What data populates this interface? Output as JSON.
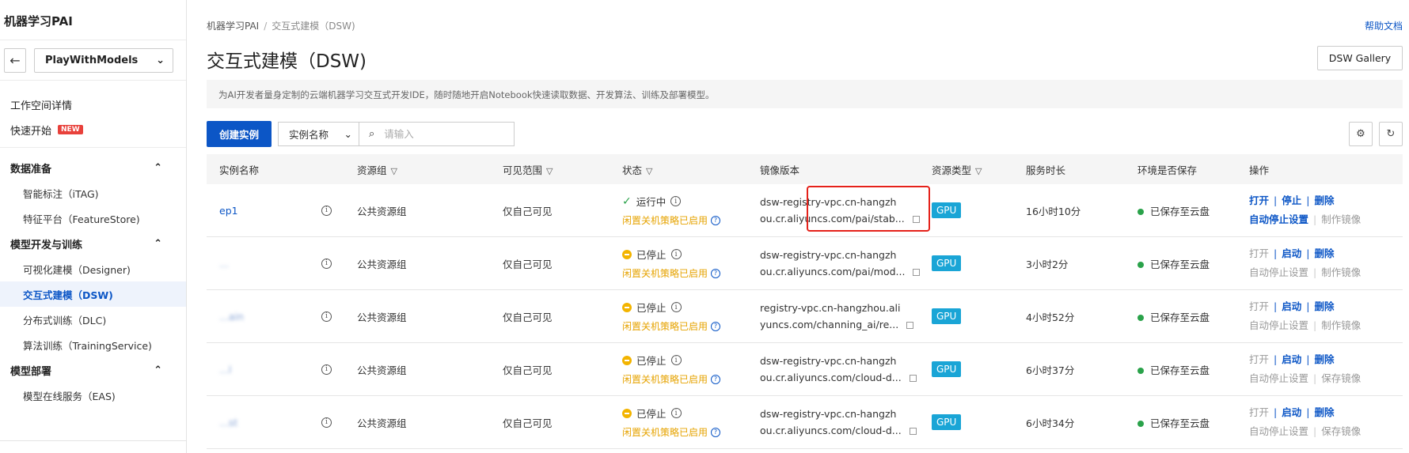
{
  "sidebar": {
    "brand": "机器学习PAI",
    "workspace": "PlayWithModels",
    "top_items": [
      {
        "label": "工作空间详情"
      },
      {
        "label": "快速开始",
        "badge": "NEW"
      }
    ],
    "groups": [
      {
        "label": "数据准备",
        "items": [
          "智能标注（iTAG)",
          "特征平台（FeatureStore)"
        ]
      },
      {
        "label": "模型开发与训练",
        "items": [
          "可视化建模（Designer)",
          "交互式建模（DSW)",
          "分布式训练（DLC)",
          "算法训练（TrainingService)"
        ]
      },
      {
        "label": "模型部署",
        "items": [
          "模型在线服务（EAS)"
        ]
      }
    ]
  },
  "header": {
    "breadcrumb": [
      "机器学习PAI",
      "交互式建模（DSW)"
    ],
    "help": "帮助文档",
    "title": "交互式建模（DSW)",
    "gallery_button": "DSW Gallery",
    "description": "为AI开发者量身定制的云端机器学习交互式开发IDE，随时随地开启Notebook快速读取数据、开发算法、训练及部署模型。"
  },
  "toolbar": {
    "create_button": "创建实例",
    "filter_select": "实例名称",
    "search_placeholder": "请输入"
  },
  "table": {
    "headers": [
      "实例名称",
      "资源组",
      "可见范围",
      "状态",
      "镜像版本",
      "资源类型",
      "服务时长",
      "环境是否保存",
      "操作"
    ],
    "rows": [
      {
        "name": "ep1",
        "resource_group": "公共资源组",
        "visibility": "仅自己可见",
        "status": "运行中",
        "idle_policy": "闲置关机策略已启用",
        "image_line1": "dsw-registry-vpc.cn-hangzh",
        "image_line2": "ou.cr.aliyuncs.com/pai/stab...",
        "resource_type": "GPU",
        "duration": "16小时10分",
        "env_saved": "已保存至云盘",
        "ops_line1": [
          "打开",
          "停止",
          "删除"
        ],
        "ops_line2": [
          "自动停止设置",
          "制作镜像"
        ]
      },
      {
        "name": "...",
        "resource_group": "公共资源组",
        "visibility": "仅自己可见",
        "status": "已停止",
        "idle_policy": "闲置关机策略已启用",
        "image_line1": "dsw-registry-vpc.cn-hangzh",
        "image_line2": "ou.cr.aliyuncs.com/pai/mod...",
        "resource_type": "GPU",
        "duration": "3小时2分",
        "env_saved": "已保存至云盘",
        "ops_line1": [
          "打开",
          "启动",
          "删除"
        ],
        "ops_line2": [
          "自动停止设置",
          "制作镜像"
        ]
      },
      {
        "name": "...ain",
        "resource_group": "公共资源组",
        "visibility": "仅自己可见",
        "status": "已停止",
        "idle_policy": "闲置关机策略已启用",
        "image_line1": "registry-vpc.cn-hangzhou.ali",
        "image_line2": "yuncs.com/channing_ai/re...",
        "resource_type": "GPU",
        "duration": "4小时52分",
        "env_saved": "已保存至云盘",
        "ops_line1": [
          "打开",
          "启动",
          "删除"
        ],
        "ops_line2": [
          "自动停止设置",
          "制作镜像"
        ]
      },
      {
        "name": "...l",
        "resource_group": "公共资源组",
        "visibility": "仅自己可见",
        "status": "已停止",
        "idle_policy": "闲置关机策略已启用",
        "image_line1": "dsw-registry-vpc.cn-hangzh",
        "image_line2": "ou.cr.aliyuncs.com/cloud-d...",
        "resource_type": "GPU",
        "duration": "6小时37分",
        "env_saved": "已保存至云盘",
        "ops_line1": [
          "打开",
          "启动",
          "删除"
        ],
        "ops_line2": [
          "自动停止设置",
          "保存镜像"
        ]
      },
      {
        "name": "...st",
        "resource_group": "公共资源组",
        "visibility": "仅自己可见",
        "status": "已停止",
        "idle_policy": "闲置关机策略已启用",
        "image_line1": "dsw-registry-vpc.cn-hangzh",
        "image_line2": "ou.cr.aliyuncs.com/cloud-d...",
        "resource_type": "GPU",
        "duration": "6小时34分",
        "env_saved": "已保存至云盘",
        "ops_line1": [
          "打开",
          "启动",
          "删除"
        ],
        "ops_line2": [
          "自动停止设置",
          "保存镜像"
        ]
      }
    ]
  },
  "colors": {
    "primary": "#0c56c6",
    "warning": "#e6a300",
    "success": "#2aa24a",
    "gpu_badge": "#1aa5d6",
    "highlight": "#e5211a"
  }
}
